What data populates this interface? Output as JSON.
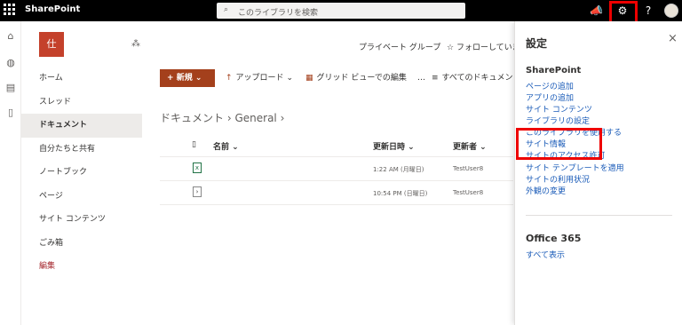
{
  "topbar": {
    "app_name": "SharePoint",
    "search_placeholder": "このライブラリを検索",
    "help_label": "?"
  },
  "site": {
    "logo_text": "仕",
    "header_links": [
      "プライベート グループ",
      "フォローしていま"
    ]
  },
  "leftnav": {
    "items": [
      "ホーム",
      "スレッド",
      "ドキュメント",
      "自分たちと共有",
      "ノートブック",
      "ページ",
      "サイト コンテンツ",
      "ごみ箱",
      "編集"
    ],
    "active_index": 2
  },
  "commandbar": {
    "new_label": "新規",
    "upload_label": "アップロード",
    "grid_edit_label": "グリッド ビューでの編集",
    "more_label": "…",
    "all_docs_label": "すべてのドキュメン"
  },
  "library": {
    "breadcrumb_root": "ドキュメント",
    "breadcrumb_current": "General",
    "columns": [
      "名前",
      "更新日時",
      "更新者"
    ],
    "rows": [
      {
        "modified": "1:22 AM (月曜日)",
        "modified_by": "TestUser8"
      },
      {
        "modified": "10:54 PM (日曜日)",
        "modified_by": "TestUser8"
      }
    ]
  },
  "settings_panel": {
    "title": "設定",
    "close": "×",
    "sharepoint_heading": "SharePoint",
    "sharepoint_links": [
      "ページの追加",
      "アプリの追加",
      "サイト コンテンツ",
      "ライブラリの設定",
      "このライブラリを使用する",
      "サイト情報",
      "サイトのアクセス許可",
      "サイト テンプレートを適用",
      "サイトの利用状況",
      "外観の変更"
    ],
    "office_heading": "Office 365",
    "office_link": "すべて表示"
  },
  "colors": {
    "accent": "#a4401c",
    "link": "#1a5bb8",
    "highlight": "#ee0000"
  }
}
